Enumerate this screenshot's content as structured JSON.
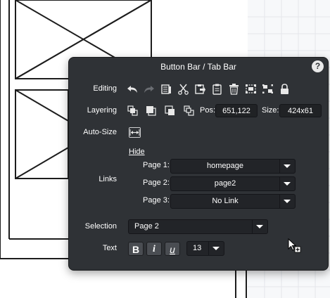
{
  "panel": {
    "title": "Button Bar / Tab Bar",
    "help_label": "?"
  },
  "rows": {
    "editing_label": "Editing",
    "layering_label": "Layering",
    "autosize_label": "Auto-Size",
    "links_label": "Links",
    "selection_label": "Selection",
    "text_label": "Text"
  },
  "editing_icons": [
    "undo-icon",
    "redo-icon",
    "copy-icon",
    "cut-icon",
    "paste-icon",
    "clipboard-icon",
    "delete-icon",
    "group-icon",
    "ungroup-icon",
    "lock-icon"
  ],
  "layering_icons": [
    "bring-to-front-icon",
    "bring-forward-icon",
    "send-backward-icon",
    "send-to-back-icon"
  ],
  "position": {
    "label": "Pos:",
    "value": "651,122"
  },
  "size": {
    "label": "Size:",
    "value": "424x61"
  },
  "links": {
    "hide_label": "Hide",
    "pages": [
      {
        "label": "Page 1:",
        "value": "homepage"
      },
      {
        "label": "Page 2:",
        "value": "page2"
      },
      {
        "label": "Page 3:",
        "value": "No Link"
      }
    ]
  },
  "selection": {
    "value": "Page 2"
  },
  "text": {
    "bold_label": "B",
    "italic_label": "i",
    "underline_label": "u",
    "font_size": "13"
  },
  "colors": {
    "panel_bg": "#2f3236",
    "field_bg": "#202225",
    "icon_color": "#e8e8e8"
  }
}
